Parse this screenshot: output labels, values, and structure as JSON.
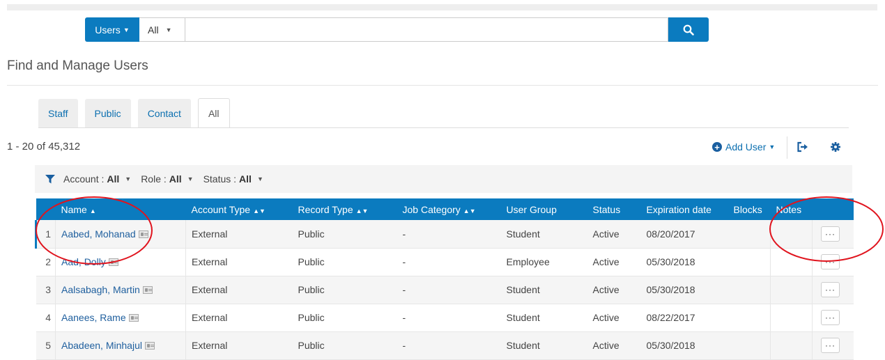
{
  "search": {
    "scope": "Users",
    "filter": "All",
    "query": "",
    "button": "search-icon"
  },
  "page": {
    "title": "Find and Manage Users",
    "count": "1 - 20 of 45,312"
  },
  "tabs": [
    {
      "label": "Staff",
      "active": false
    },
    {
      "label": "Public",
      "active": false
    },
    {
      "label": "Contact",
      "active": false
    },
    {
      "label": "All",
      "active": true
    }
  ],
  "toolbar": {
    "add_user": "Add User",
    "export_icon": "export-icon",
    "settings_icon": "gear-icon"
  },
  "filters": [
    {
      "label": "Account :",
      "value": "All"
    },
    {
      "label": "Role :",
      "value": "All"
    },
    {
      "label": "Status :",
      "value": "All"
    }
  ],
  "table": {
    "columns": [
      "Name",
      "Account Type",
      "Record Type",
      "Job Category",
      "User Group",
      "Status",
      "Expiration date",
      "Blocks",
      "Notes"
    ],
    "rows": [
      {
        "index": "1",
        "name": "Aabed, Mohanad",
        "account_type": "External",
        "record_type": "Public",
        "job_category": "-",
        "user_group": "Student",
        "status": "Active",
        "expiration": "08/20/2017",
        "blocks": "",
        "notes": ""
      },
      {
        "index": "2",
        "name": "Aad, Dolly",
        "account_type": "External",
        "record_type": "Public",
        "job_category": "-",
        "user_group": "Employee",
        "status": "Active",
        "expiration": "05/30/2018",
        "blocks": "",
        "notes": ""
      },
      {
        "index": "3",
        "name": "Aalsabagh, Martin",
        "account_type": "External",
        "record_type": "Public",
        "job_category": "-",
        "user_group": "Student",
        "status": "Active",
        "expiration": "05/30/2018",
        "blocks": "",
        "notes": ""
      },
      {
        "index": "4",
        "name": "Aanees, Rame",
        "account_type": "External",
        "record_type": "Public",
        "job_category": "-",
        "user_group": "Student",
        "status": "Active",
        "expiration": "08/22/2017",
        "blocks": "",
        "notes": ""
      },
      {
        "index": "5",
        "name": "Abadeen, Minhajul",
        "account_type": "External",
        "record_type": "Public",
        "job_category": "-",
        "user_group": "Student",
        "status": "Active",
        "expiration": "05/30/2018",
        "blocks": "",
        "notes": ""
      }
    ],
    "row_action": "···"
  },
  "colors": {
    "accent": "#0b7bbf",
    "link": "#1f5f9e",
    "annotation": "#e0141e"
  }
}
